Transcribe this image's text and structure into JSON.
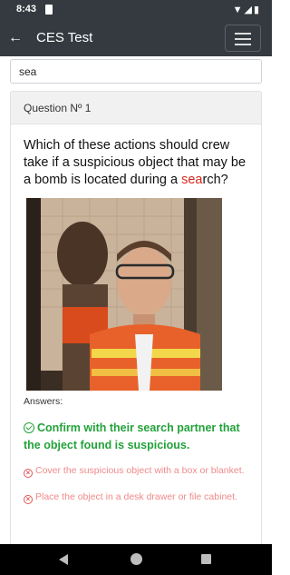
{
  "status_bar": {
    "time": "8:43",
    "system_icons": "▼◢▮"
  },
  "app_bar": {
    "back_icon": "←",
    "title": "CES Test",
    "menu_icon": "hamburger-menu"
  },
  "search": {
    "value": "sea",
    "placeholder": ""
  },
  "question_card": {
    "header": "Question Nº 1",
    "text_before": "Which of these actions should crew take if a suspicious object that may be a bomb is located during a ",
    "text_highlight": "sea",
    "text_after": "rch?",
    "answers_label": "Answers:",
    "answers": [
      {
        "text": "Confirm with their search partner that the object found is suspicious.",
        "correct": true
      },
      {
        "text": "Cover the suspicious object with a box or blanket.",
        "correct": false
      },
      {
        "text": "Place the object in a desk drawer or file cabinet.",
        "correct": false
      }
    ]
  },
  "colors": {
    "app_bar": "#343a40",
    "highlight": "#d9281e",
    "correct": "#23a23a",
    "wrong": "#f08a8a"
  }
}
